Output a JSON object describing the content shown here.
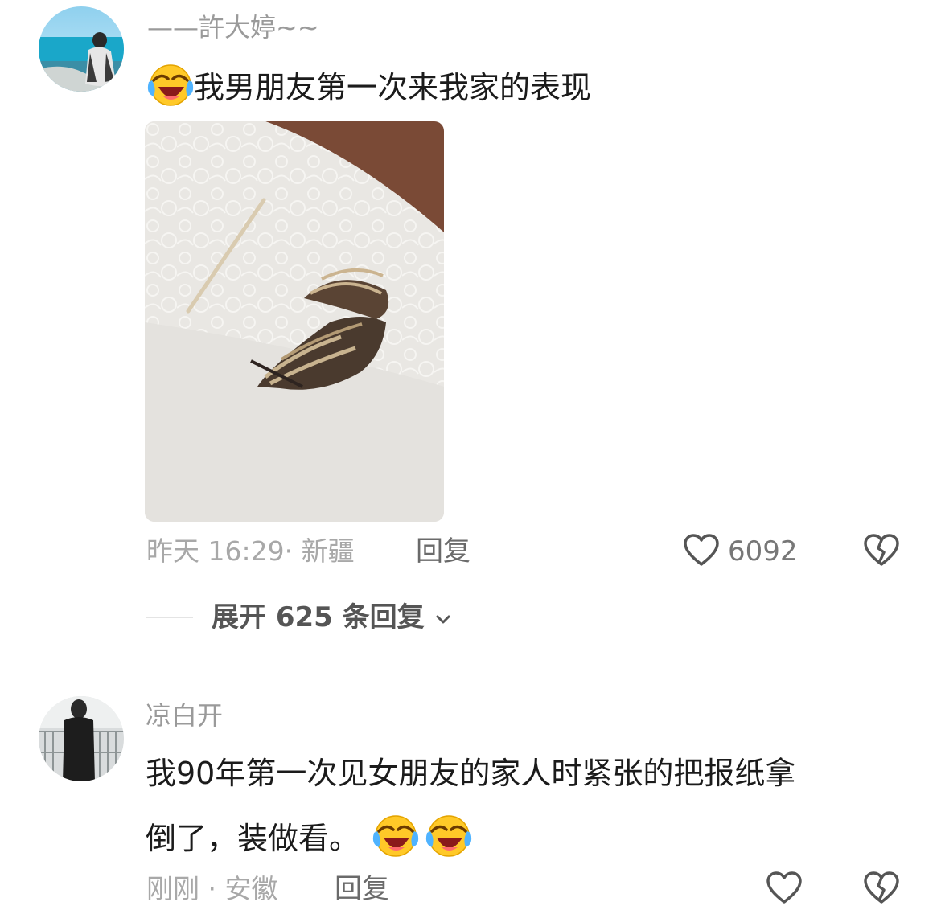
{
  "comments": [
    {
      "username": "——許大婷~~",
      "text": "我男朋友第一次来我家的表现",
      "time_location": "昨天 16:29· 新疆",
      "reply_label": "回复",
      "like_count": "6092",
      "expand_replies": "展开 625 条回复"
    },
    {
      "username": "凉白开",
      "text_line1": "我90年第一次见女朋友的家人时紧张的把报纸拿",
      "text_line2": "倒了，装做看。",
      "time_location": "刚刚 · 安徽",
      "reply_label": "回复"
    }
  ],
  "icons": {
    "emoji": "laughing-crying-emoji",
    "like": "heart-outline-icon",
    "dislike": "broken-heart-icon",
    "expand": "chevron-down-icon"
  },
  "colors": {
    "username": "#9a9a9a",
    "text": "#1b1b1b",
    "meta": "#a8a8a8"
  }
}
